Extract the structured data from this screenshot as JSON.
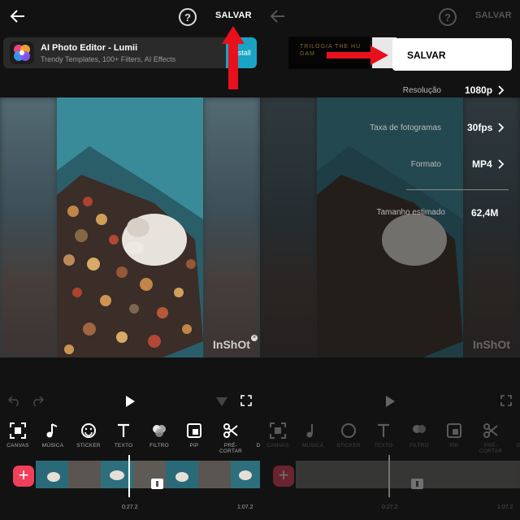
{
  "left": {
    "header": {
      "save_label": "SALVAR",
      "help_symbol": "?"
    },
    "ad": {
      "title": "AI Photo Editor - Lumii",
      "subtitle": "Trendy Templates, 100+ Filters, AI Effects",
      "install_label": "Install"
    },
    "watermark": "InShOt",
    "tools": [
      {
        "label": "CANVAS",
        "icon": "canvas-icon"
      },
      {
        "label": "MÚSICA",
        "icon": "music-note-icon"
      },
      {
        "label": "STICKER",
        "icon": "smiley-icon"
      },
      {
        "label": "TEXTO",
        "icon": "text-t-icon"
      },
      {
        "label": "FILTRO",
        "icon": "filter-circles-icon"
      },
      {
        "label": "PIP",
        "icon": "pip-icon"
      },
      {
        "label": "PRÉ-CORTAR",
        "icon": "scissors-icon"
      },
      {
        "label": "D"
      }
    ],
    "timeline": {
      "current_time": "0:27.2",
      "total_time": "1:07.2",
      "add_symbol": "+"
    }
  },
  "right": {
    "header": {
      "save_label": "SALVAR",
      "help_symbol": "?"
    },
    "ad_text": "TRILOGIA THE HU GAM",
    "save_button_label": "SALVAR",
    "settings": [
      {
        "label": "Resolução",
        "value": "1080p"
      },
      {
        "label": "Taxa de fotogramas",
        "value": "30fps"
      },
      {
        "label": "Formato",
        "value": "MP4"
      },
      {
        "label": "Tamanho estimado",
        "value": "62,4M"
      }
    ],
    "watermark": "InShOt",
    "tools": [
      {
        "label": "CANVAS"
      },
      {
        "label": "MÚSICA"
      },
      {
        "label": "STICKER"
      },
      {
        "label": "TEXTO"
      },
      {
        "label": "FILTRO"
      },
      {
        "label": "PIP"
      },
      {
        "label": "PRÉ-CORTAR"
      },
      {
        "label": "D"
      }
    ],
    "timeline": {
      "current_time": "0:27.2",
      "total_time": "1:07.2",
      "add_symbol": "+"
    }
  },
  "colors": {
    "accent_red": "#ef3f5b",
    "annotation_red": "#e8101c",
    "ad_install": "#1aa3c4"
  }
}
